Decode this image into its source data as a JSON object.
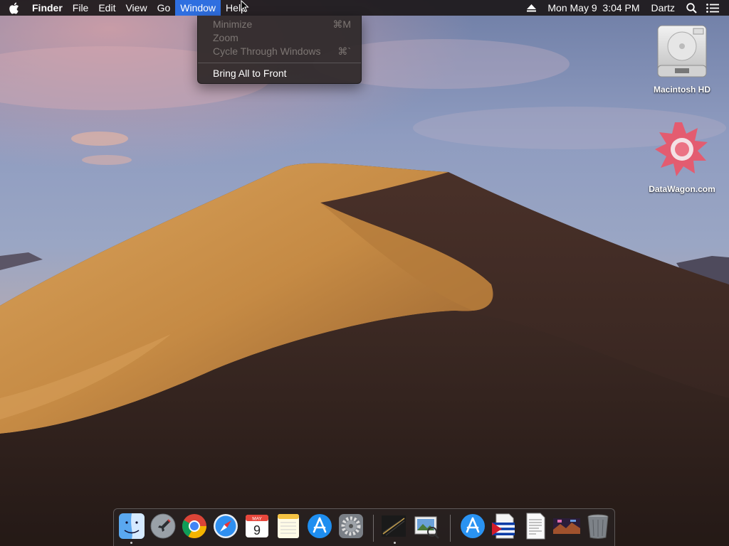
{
  "menubar": {
    "app_name": "Finder",
    "menus": [
      "File",
      "Edit",
      "View",
      "Go",
      "Window",
      "Help"
    ],
    "active_menu": "Window",
    "status": {
      "datetime": "Mon May 9  3:04 PM",
      "user": "Dartz"
    }
  },
  "window_menu": {
    "items": [
      {
        "label": "Minimize",
        "shortcut": "⌘M",
        "enabled": false
      },
      {
        "label": "Zoom",
        "shortcut": "",
        "enabled": false
      },
      {
        "label": "Cycle Through Windows",
        "shortcut": "⌘`",
        "enabled": false
      },
      {
        "label": "Bring All to Front",
        "shortcut": "",
        "enabled": true
      }
    ]
  },
  "desktop": {
    "icons": [
      {
        "label": "Macintosh HD",
        "icon": "hard-drive-icon"
      },
      {
        "label": "DataWagon.com",
        "icon": "datawagon-logo-icon"
      }
    ]
  },
  "dock": {
    "items": [
      {
        "name": "finder",
        "icon": "finder-icon",
        "running": true
      },
      {
        "name": "launchpad",
        "icon": "launchpad-icon",
        "running": false
      },
      {
        "name": "chrome",
        "icon": "chrome-icon",
        "running": false
      },
      {
        "name": "safari",
        "icon": "safari-icon",
        "running": false
      },
      {
        "name": "calendar",
        "icon": "calendar-icon",
        "running": false,
        "month": "MAY",
        "day": "9"
      },
      {
        "name": "notes",
        "icon": "notes-icon",
        "running": false
      },
      {
        "name": "app-store",
        "icon": "app-store-icon",
        "running": false
      },
      {
        "name": "system-preferences",
        "icon": "gear-icon",
        "running": false
      },
      {
        "name": "console",
        "icon": "console-icon",
        "running": true
      },
      {
        "name": "preview",
        "icon": "preview-icon",
        "running": false
      },
      {
        "name": "app-store-folder",
        "icon": "app-store-icon",
        "running": false
      },
      {
        "name": "flag-document",
        "icon": "document-icon",
        "running": false
      },
      {
        "name": "text-document",
        "icon": "document-icon",
        "running": false
      },
      {
        "name": "screenshot",
        "icon": "image-icon",
        "running": false
      },
      {
        "name": "trash",
        "icon": "trash-icon",
        "running": false
      }
    ]
  },
  "colors": {
    "menu_highlight": "#2f6fe0",
    "disabled_text": "#7d7673"
  }
}
